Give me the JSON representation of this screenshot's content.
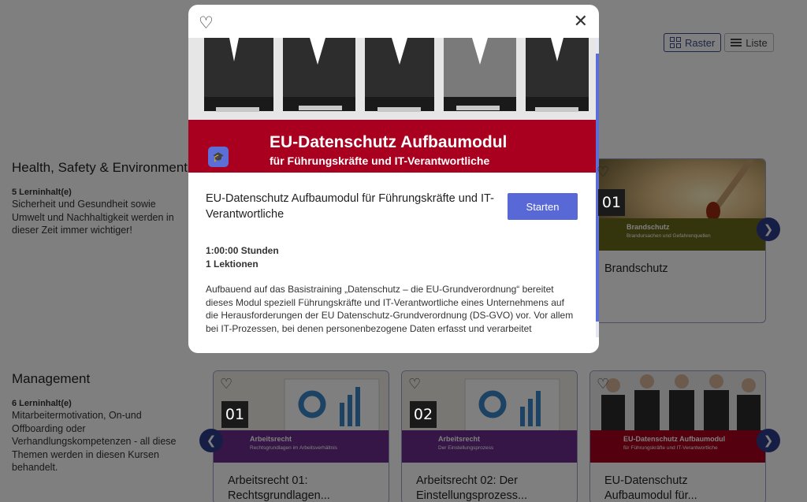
{
  "view_toggle": {
    "raster_label": "Raster",
    "list_label": "Liste"
  },
  "categories": [
    {
      "title": "Health, Safety & Environment",
      "count": "5 Lerninhalt(e)",
      "description": "Sicherheit und Gesundheit sowie Umwelt und Nachhaltigkeit werden in dieser Zeit immer wichtiger!",
      "cards": [
        {
          "num": "01",
          "band_title": "Brandschutz",
          "band_sub": "Brandursachen und Gefahrenquellen",
          "title": "Brandschutz"
        }
      ]
    },
    {
      "title": "Management",
      "count": "6 Lerninhalt(e)",
      "description": "Mitarbeitermotivation, On-und Offboarding oder Verhandlungskompetenzen - all diese Themen werden in diesen Kursen behandelt.",
      "cards": [
        {
          "num": "01",
          "band_title": "Arbeitsrecht",
          "band_sub": "Rechtsgrundlagen im Arbeitsverhältnis",
          "title": "Arbeitsrecht 01: Rechtsgrundlagen..."
        },
        {
          "num": "02",
          "band_title": "Arbeitsrecht",
          "band_sub": "Der Einstellungsprozess",
          "title": "Arbeitsrecht 02: Der Einstellungsprozess..."
        },
        {
          "band_title": "EU-Datenschutz Aufbaumodul",
          "band_sub": "für Führungskräfte und IT-Verantwortliche",
          "title": "EU-Datenschutz Aufbaumodul für..."
        }
      ]
    }
  ],
  "modal": {
    "banner_title": "EU-Datenschutz Aufbaumodul",
    "banner_subtitle": "für Führungskräfte und IT-Verantwortliche",
    "title": "EU-Datenschutz Aufbaumodul für Führungskräfte und IT-Verantwortliche",
    "start_label": "Starten",
    "duration": "1:00:00 Stunden",
    "lessons": "1 Lektionen",
    "description": "Aufbauend auf das Basistraining „Datenschutz – die EU-Grundverordnung“ bereitet dieses Modul speziell Führungskräfte und IT-Verantwortliche eines Unternehmens auf die Herausforderungen der EU Datenschutz-Grundverordnung (DS-GVO) vor. Vor allem bei IT-Prozessen, bei denen personenbezogene Daten erfasst und verarbeitet"
  },
  "colors": {
    "accent": "#5868d6",
    "arrow": "#2f3d8a",
    "banner_red": "#a8001e",
    "purple_band": "#6a2d8c",
    "olive_band": "#6b6a1a"
  }
}
